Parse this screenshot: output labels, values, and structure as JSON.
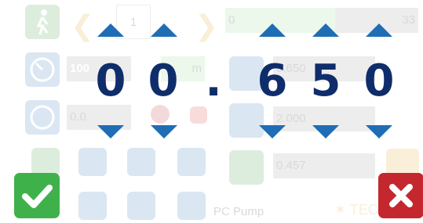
{
  "background": {
    "step_value": "1",
    "progress_value": "0",
    "progress_total": "33",
    "field_percent": "100",
    "field_green_partial": "m",
    "field_ab": "0.0",
    "field_right_top": "0.650",
    "field_right_mid": "2.000",
    "field_right_bottom": "0.457",
    "footer_label": "PC Pump",
    "brand_text": "TECH"
  },
  "editor": {
    "digits": [
      "0",
      "0",
      ".",
      "6",
      "5",
      "0"
    ]
  },
  "buttons": {
    "confirm_icon": "checkmark-icon",
    "cancel_icon": "close-icon"
  },
  "colors": {
    "arrow": "#1f6db5",
    "digit": "#0f2d6b",
    "confirm": "#3fb14b",
    "cancel": "#c4272e"
  }
}
